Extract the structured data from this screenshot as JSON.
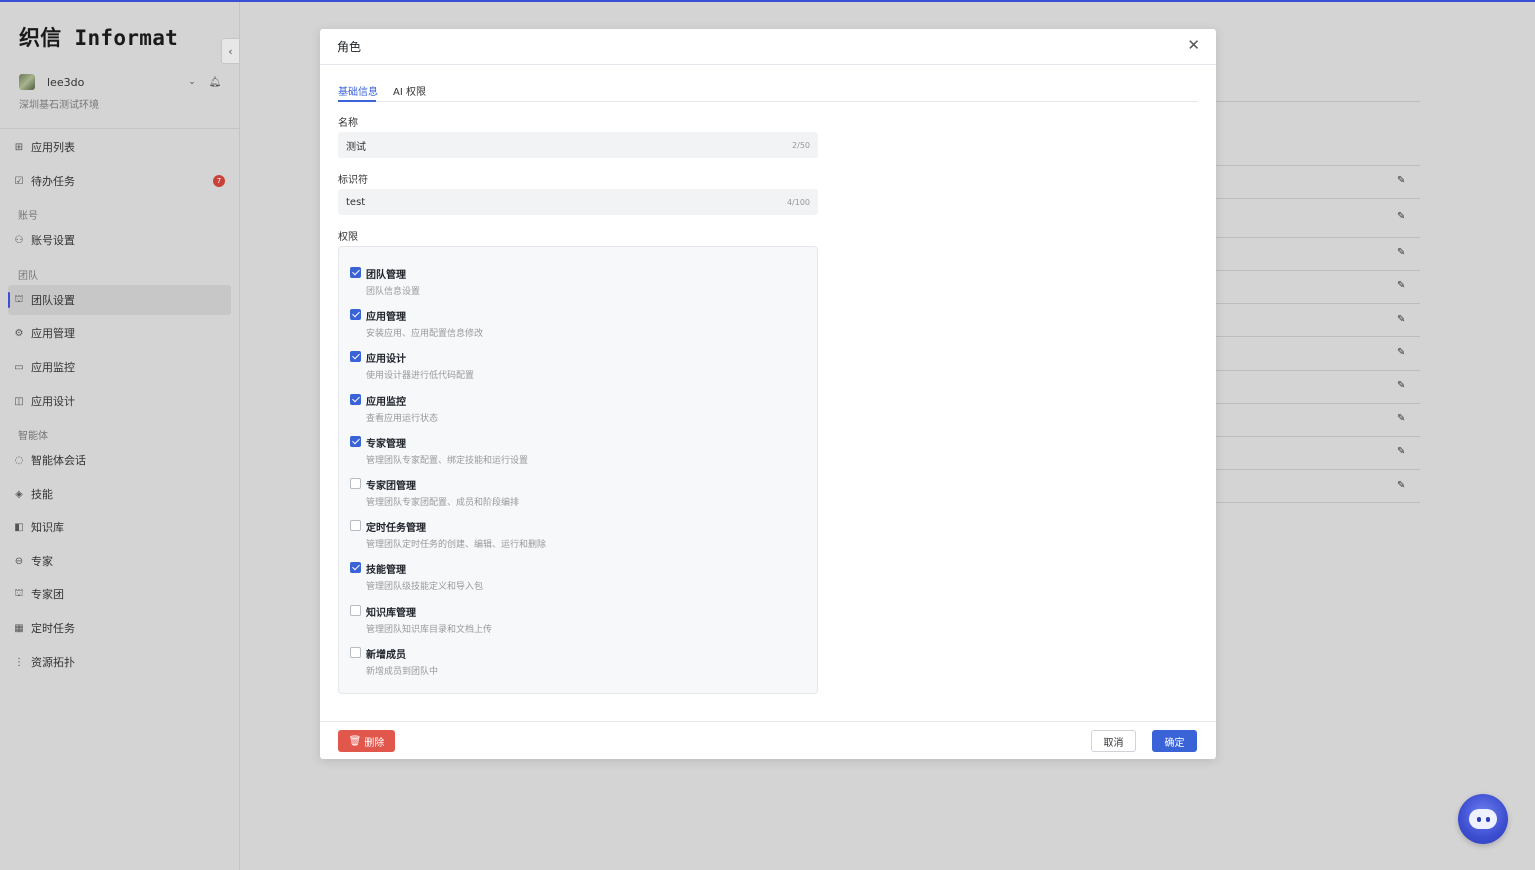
{
  "app": {
    "logo": "织信 Informat"
  },
  "user": {
    "name": "lee3do",
    "env": "深圳基石测试环境"
  },
  "nav": {
    "apps": "应用列表",
    "todo": "待办任务",
    "todo_badge": "7",
    "section_account": "账号",
    "account_settings": "账号设置",
    "section_team": "团队",
    "team_settings": "团队设置",
    "app_manage": "应用管理",
    "app_monitor": "应用监控",
    "app_design": "应用设计",
    "section_agent": "智能体",
    "agent_chat": "智能体会话",
    "skills": "技能",
    "knowledge": "知识库",
    "expert": "专家",
    "expert_team": "专家团",
    "scheduled": "定时任务",
    "topology": "资源拓扑"
  },
  "modal": {
    "title": "角色",
    "tabs": [
      "基础信息",
      "AI 权限"
    ],
    "name_label": "名称",
    "name_value": "测试",
    "name_count": "2/50",
    "id_label": "标识符",
    "id_value": "test",
    "id_count": "4/100",
    "perm_label": "权限",
    "permissions": [
      {
        "name": "团队管理",
        "desc": "团队信息设置",
        "checked": true
      },
      {
        "name": "应用管理",
        "desc": "安装应用、应用配置信息修改",
        "checked": true
      },
      {
        "name": "应用设计",
        "desc": "使用设计器进行低代码配置",
        "checked": true
      },
      {
        "name": "应用监控",
        "desc": "查看应用运行状态",
        "checked": true
      },
      {
        "name": "专家管理",
        "desc": "管理团队专家配置、绑定技能和运行设置",
        "checked": true
      },
      {
        "name": "专家团管理",
        "desc": "管理团队专家团配置、成员和阶段编排",
        "checked": false
      },
      {
        "name": "定时任务管理",
        "desc": "管理团队定时任务的创建、编辑、运行和删除",
        "checked": false
      },
      {
        "name": "技能管理",
        "desc": "管理团队级技能定义和导入包",
        "checked": true
      },
      {
        "name": "知识库管理",
        "desc": "管理团队知识库目录和文档上传",
        "checked": false
      },
      {
        "name": "新增成员",
        "desc": "新增成员到团队中",
        "checked": false
      }
    ],
    "delete_label": "删除",
    "cancel_label": "取消",
    "ok_label": "确定"
  },
  "colors": {
    "accent": "#3a63d8",
    "danger": "#e2574c",
    "topbar": "#3a4fd6"
  }
}
